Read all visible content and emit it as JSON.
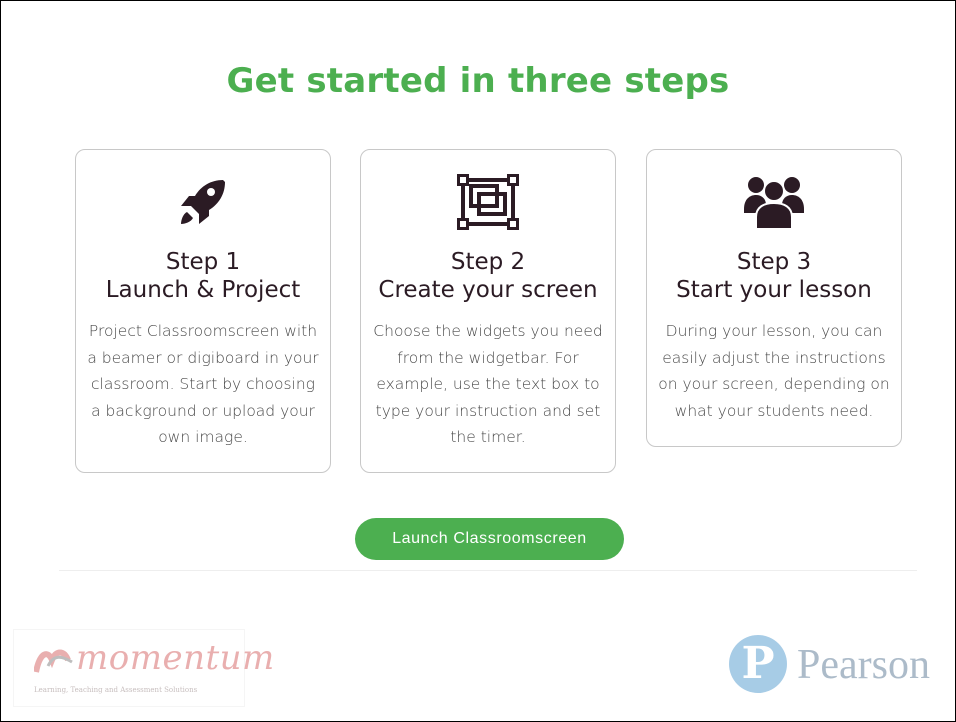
{
  "headline": "Get started in three steps",
  "steps": [
    {
      "title": "Step 1",
      "subtitle": "Launch & Project",
      "body": "Project Classroomscreen with a beamer or digiboard in your classroom. Start by choosing a background or upload your own image.",
      "icon": "rocket-icon"
    },
    {
      "title": "Step 2",
      "subtitle": "Create your screen",
      "body": "Choose the widgets you need from the widgetbar. For example, use the text box to type your instruction and set the timer.",
      "icon": "layers-frame-icon"
    },
    {
      "title": "Step 3",
      "subtitle": "Start your lesson",
      "body": "During your lesson, you can easily adjust the instructions on your screen, depending on what your students need.",
      "icon": "group-users-icon"
    }
  ],
  "launch_button": "Launch Classroomscreen",
  "footer": {
    "momentum_logo": "momentum",
    "momentum_tagline": "Learning, Teaching and Assessment Solutions",
    "pearson_logo": "Pearson"
  },
  "colors": {
    "accent_green": "#4caf50",
    "icon_dark": "#2b1b24",
    "card_border": "#c8c8c8"
  }
}
